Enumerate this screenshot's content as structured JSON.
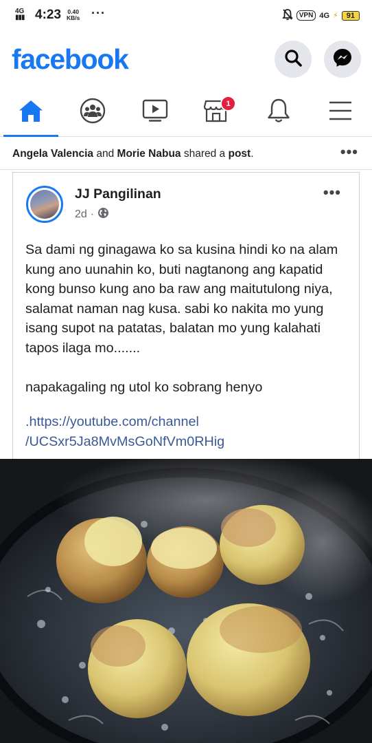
{
  "status_bar": {
    "signal": "4G",
    "time": "4:23",
    "net_speed": "0.40",
    "net_unit": "KB/s",
    "dots": "···",
    "vpn": "VPN",
    "network": "4G",
    "battery": "91"
  },
  "header": {
    "logo": "facebook",
    "icons": [
      "search-icon",
      "messenger-icon"
    ]
  },
  "nav": {
    "items": [
      "home-icon",
      "groups-icon",
      "watch-icon",
      "marketplace-icon",
      "notifications-icon",
      "menu-icon"
    ],
    "active_color": "#1877f2",
    "marketplace_badge": "1"
  },
  "shared_banner": {
    "user1": "Angela Valencia",
    "conj": "and",
    "user2": "Morie Nabua",
    "action": "shared a",
    "object": "post",
    "period": "."
  },
  "post": {
    "author": "JJ Pangilinan",
    "time": "2d",
    "separator": "·",
    "body": "Sa dami ng ginagawa ko sa kusina hindi ko na alam kung ano uunahin ko, buti nagtanong ang kapatid kong bunso kung ano ba raw ang maitutulong niya, salamat naman nag kusa. sabi ko nakita mo yung isang supot na patatas, balatan mo yung kalahati tapos ilaga mo.......\n\nnapakagaling ng utol ko  sobrang henyo",
    "link": ".https://youtube.com/channel\n/UCSxr5Ja8MvMsGoNfVm0RHig"
  },
  "colors": {
    "brand": "#1877f2",
    "badge": "#e41e3f",
    "link": "#385898"
  }
}
